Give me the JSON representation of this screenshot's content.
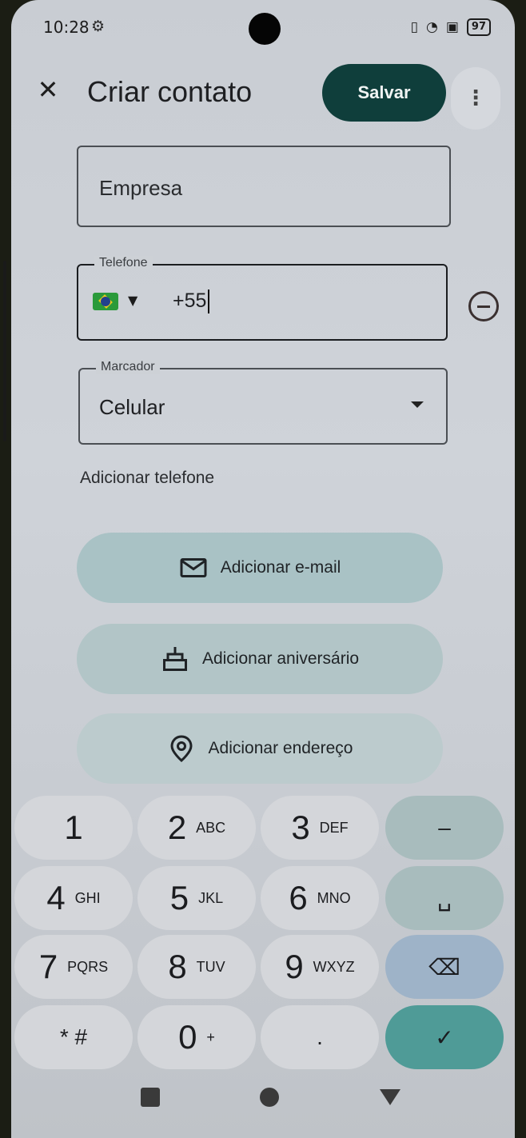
{
  "status_bar": {
    "time": "10:28",
    "battery": "97"
  },
  "header": {
    "title": "Criar contato",
    "save_label": "Salvar"
  },
  "form": {
    "company_value": "Empresa",
    "phone_legend": "Telefone",
    "phone_value": "+55",
    "label_legend": "Marcador",
    "label_value": "Celular",
    "add_phone": "Adicionar telefone"
  },
  "actions": {
    "email": "Adicionar e-mail",
    "birthday": "Adicionar aniversário",
    "address": "Adicionar endereço"
  },
  "keypad": {
    "k1": "1",
    "k2": "2",
    "k2_letters": "ABC",
    "k3": "3",
    "k3_letters": "DEF",
    "k4": "4",
    "k4_letters": "GHI",
    "k5": "5",
    "k5_letters": "JKL",
    "k6": "6",
    "k6_letters": "MNO",
    "k7": "7",
    "k7_letters": "PQRS",
    "k8": "8",
    "k8_letters": "TUV",
    "k9": "9",
    "k9_letters": "WXYZ",
    "kstar": "* #",
    "k0": "0",
    "k0_letters": "+",
    "kdot": ".",
    "kminus": "–"
  },
  "colors": {
    "save_button": "#0f3e3b",
    "accent_pill": "#a9c2c5",
    "confirm_key": "#4f9b97"
  }
}
